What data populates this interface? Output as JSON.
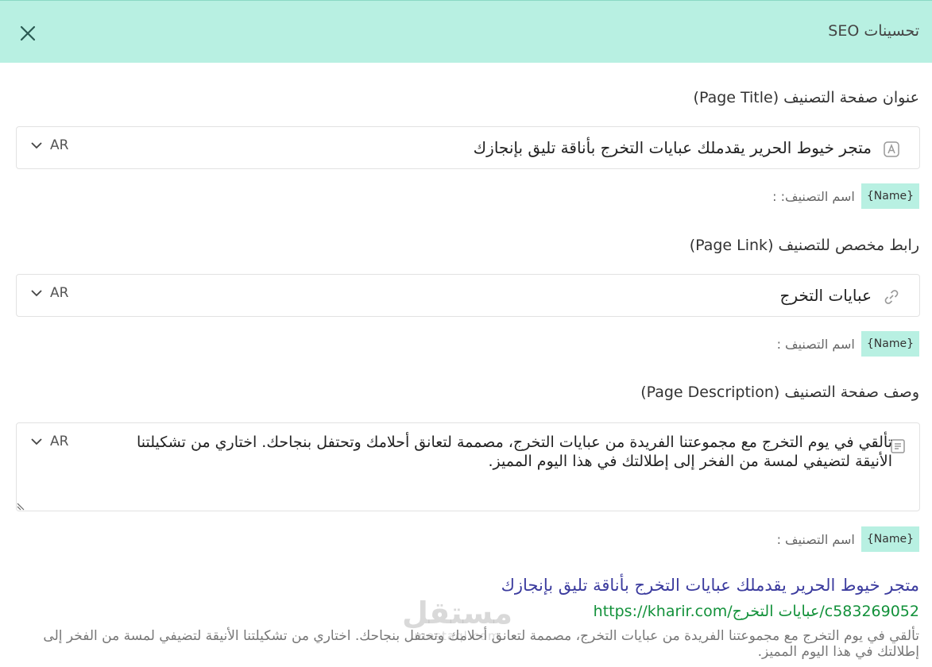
{
  "header": {
    "title": "تحسينات SEO"
  },
  "page_title": {
    "label": "عنوان صفحة التصنيف (Page Title)",
    "value": "متجر خيوط الحرير يقدملك عبايات التخرج بأناقة تليق بإنجازك",
    "lang": "AR",
    "hint_label": "اسم التصنيف: :",
    "tag": "{Name}"
  },
  "page_link": {
    "label": "رابط مخصص للتصنيف (Page Link)",
    "value": "عبايات التخرج",
    "lang": "AR",
    "hint_label": "اسم التصنيف :",
    "tag": "{Name}"
  },
  "page_description": {
    "label": "وصف صفحة التصنيف (Page Description)",
    "value": "تألقي في يوم التخرج مع مجموعتنا الفريدة من عبايات التخرج، مصممة لتعانق أحلامك وتحتفل بنجاحك. اختاري من تشكيلتنا الأنيقة لتضيفي لمسة من الفخر إلى إطلالتك في هذا اليوم المميز.",
    "lang": "AR",
    "hint_label": "اسم التصنيف :",
    "tag": "{Name}"
  },
  "preview": {
    "title": "متجر خيوط الحرير يقدملك عبايات التخرج بأناقة تليق بإنجازك",
    "url": "https://kharir.com/عبايات التخرج/c583269052",
    "description": "تألقي في يوم التخرج مع مجموعتنا الفريدة من عبايات التخرج، مصممة لتعانق أحلامك وتحتفل بنجاحك. اختاري من تشكيلتنا الأنيقة لتضيفي لمسة من الفخر إلى إطلالتك في هذا اليوم المميز."
  },
  "watermark": {
    "main": "مستقل",
    "sub": "mostaql.com"
  },
  "colors": {
    "accent": "#b8f0e2",
    "link_title": "#3b3b9e",
    "link_url": "#12913a"
  },
  "icons": {
    "close": "close-icon",
    "title_field": "text-icon",
    "link_field": "link-icon",
    "description_field": "document-icon",
    "dropdown": "chevron-down-icon"
  }
}
